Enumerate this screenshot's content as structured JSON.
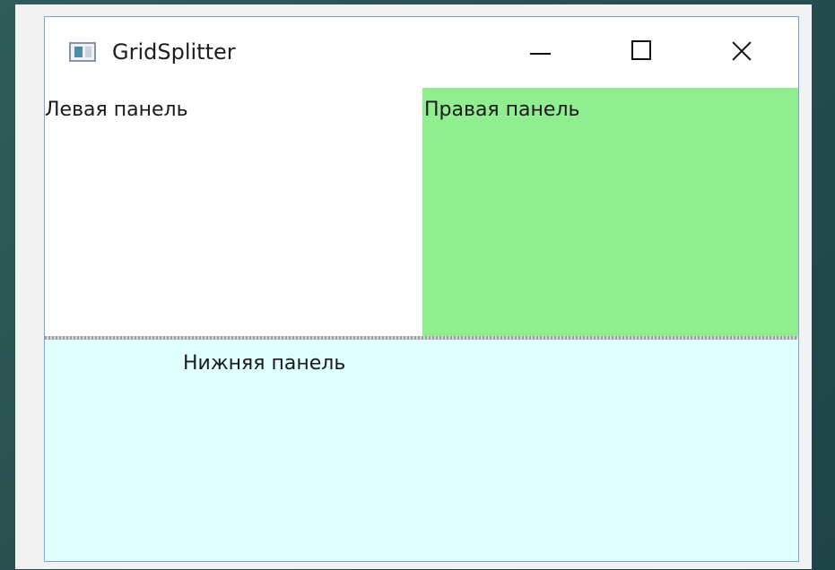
{
  "window": {
    "title": "GridSplitter",
    "icon": "app-window-icon"
  },
  "controls": {
    "minimize": "minimize-icon",
    "maximize": "maximize-icon",
    "close": "close-icon"
  },
  "panels": {
    "left_label": "Левая панель",
    "right_label": "Правая панель",
    "bottom_label": "Нижняя панель"
  },
  "colors": {
    "right_panel": "#90ee90",
    "bottom_panel": "#e0ffff",
    "window_border": "#7aa3d6"
  }
}
